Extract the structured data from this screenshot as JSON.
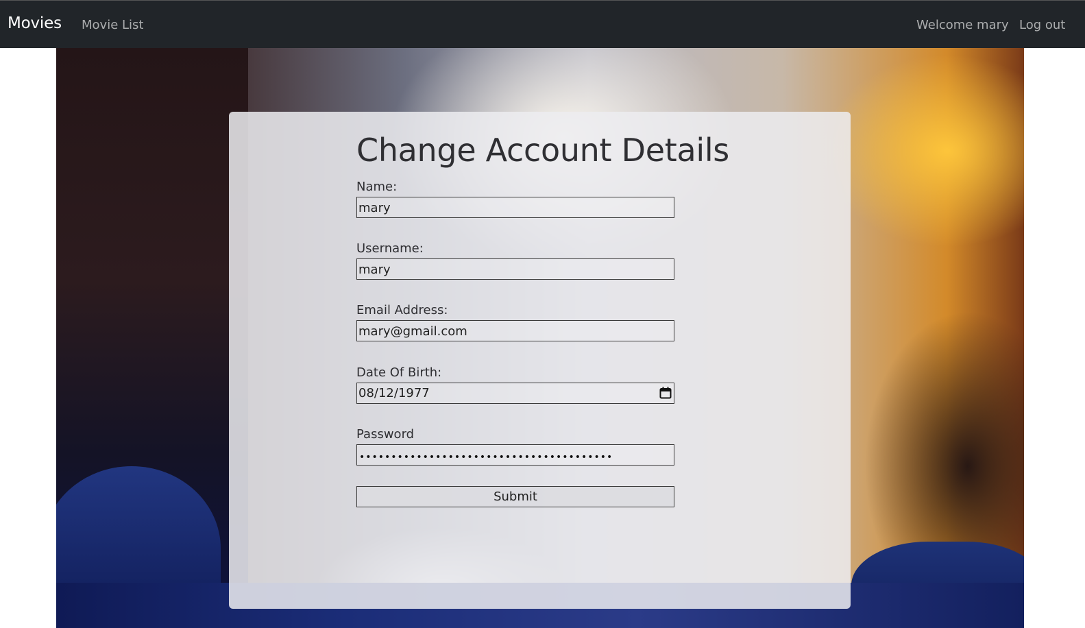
{
  "navbar": {
    "brand": "Movies",
    "movie_list_link": "Movie List",
    "welcome_text": "Welcome mary",
    "logout_link": "Log out"
  },
  "form": {
    "title": "Change Account Details",
    "name": {
      "label": "Name:",
      "value": "mary"
    },
    "username": {
      "label": "Username:",
      "value": "mary"
    },
    "email": {
      "label": "Email Address:",
      "value": "mary@gmail.com"
    },
    "dob": {
      "label": "Date Of Birth:",
      "value": "08/12/1977",
      "icon": "calendar-icon"
    },
    "password": {
      "label": "Password",
      "masked_value": "••••••••••••••••••••••••••••••••••••••••"
    },
    "submit_label": "Submit"
  },
  "background": {
    "description_color": "#212529"
  }
}
